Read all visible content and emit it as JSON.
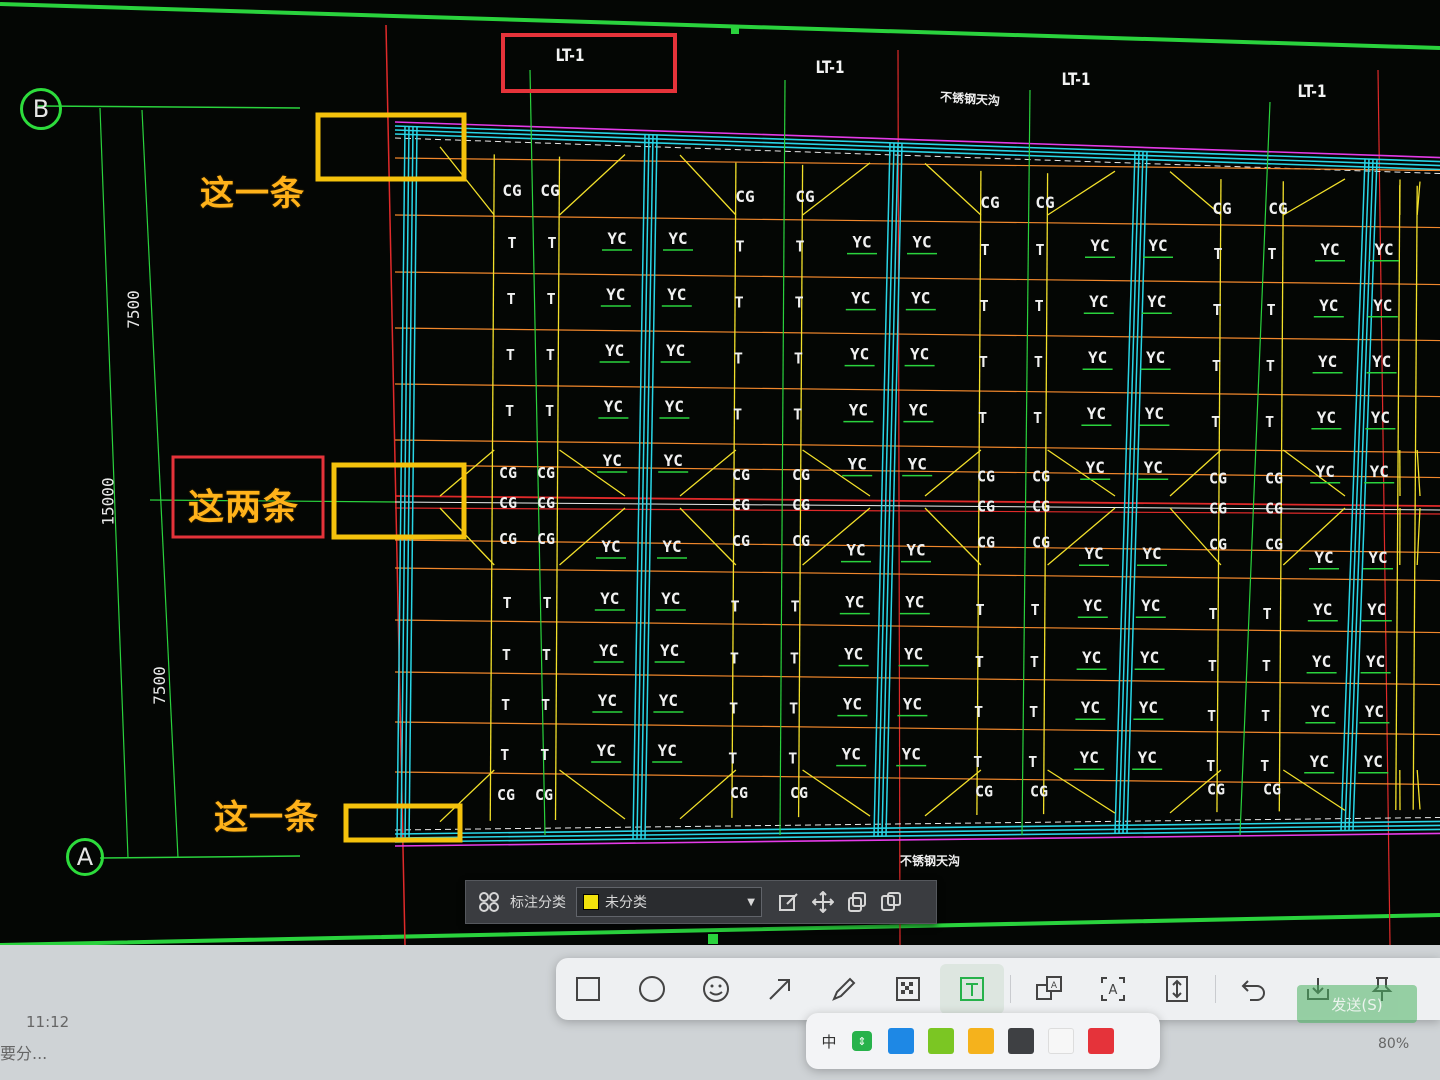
{
  "drawing": {
    "axis_b": "B",
    "axis_a": "A",
    "dim_top": "7500",
    "dim_total": "15000",
    "dim_bottom": "7500",
    "lt_labels": [
      "LT-1",
      "LT-1",
      "LT-1",
      "LT-1"
    ],
    "note_top": "不锈钢天沟",
    "note_bottom": "不锈钢天沟",
    "tag_cg": "CG",
    "tag_t": "T",
    "tag_yc": "YC"
  },
  "annotations": {
    "top": "这一条",
    "middle": "这两条",
    "bottom": "这一条"
  },
  "annot_toolbar": {
    "category_label": "标注分类",
    "category_value": "未分类",
    "category_color": "#f2e20c"
  },
  "snip_toolbar": {
    "tools": [
      "rectangle-icon",
      "ellipse-icon",
      "emoji-icon",
      "arrow-icon",
      "pen-icon",
      "mosaic-icon",
      "text-icon",
      "translate-icon",
      "ocr-icon",
      "long-screenshot-icon",
      "undo-icon",
      "save-icon",
      "pin-icon"
    ],
    "active_tool": "text-icon",
    "send_label": "发送(S)"
  },
  "color_bar": {
    "size_label": "中",
    "colors": [
      "#1e88e5",
      "#7bc623",
      "#f5b21c",
      "#3e4043",
      "#f7f7f7",
      "#e5333a"
    ]
  },
  "taskbar": {
    "time": "11:12",
    "text": "要分...",
    "zoom": "80%"
  }
}
